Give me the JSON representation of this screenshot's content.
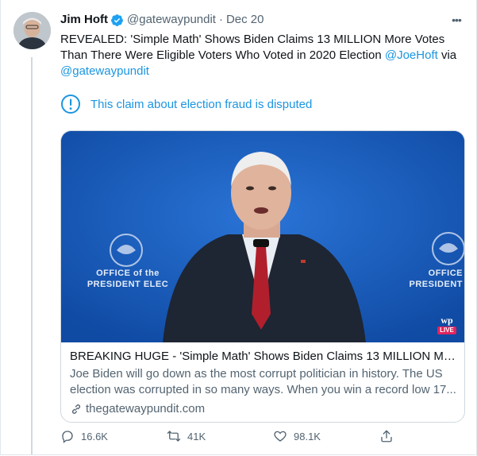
{
  "tweet": {
    "author_name": "Jim Hoft",
    "handle": "@gatewaypundit",
    "separator": "·",
    "date": "Dec 20",
    "more_label": "•••",
    "text_part1": "REVEALED: 'Simple Math' Shows Biden Claims 13 MILLION More Votes Than There Were Eligible Voters Who Voted in 2020 Election ",
    "mention1": "@JoeHoft",
    "text_part2": " via ",
    "mention2": "@gatewaypundit",
    "notice": "This claim about election fraud is disputed",
    "card": {
      "title": "BREAKING HUGE - 'Simple Math' Shows Biden Claims 13 MILLION More...",
      "description": "Joe Biden will go down as the most corrupt politician in history. The US election was corrupted in so many ways. When you win a record low 17...",
      "domain": "thegatewaypundit.com",
      "image_seal_text_left_1": "OFFICE of the",
      "image_seal_text_left_2": "PRESIDENT ELEC",
      "image_seal_text_right_1": "OFFICE",
      "image_seal_text_right_2": "PRESIDENT",
      "badge_logo": "wp",
      "badge_live": "LIVE"
    },
    "stats": {
      "replies": "16.6K",
      "retweets": "41K",
      "likes": "98.1K"
    }
  },
  "colors": {
    "accent": "#1b95e0",
    "secondary_text": "#536471",
    "stage_blue": "#1a5fbf"
  },
  "icons": {
    "verified": "verified-badge-icon",
    "notice": "exclamation-circle-icon",
    "domain": "link-icon",
    "reply": "reply-icon",
    "retweet": "retweet-icon",
    "like": "heart-icon",
    "share": "share-icon"
  }
}
